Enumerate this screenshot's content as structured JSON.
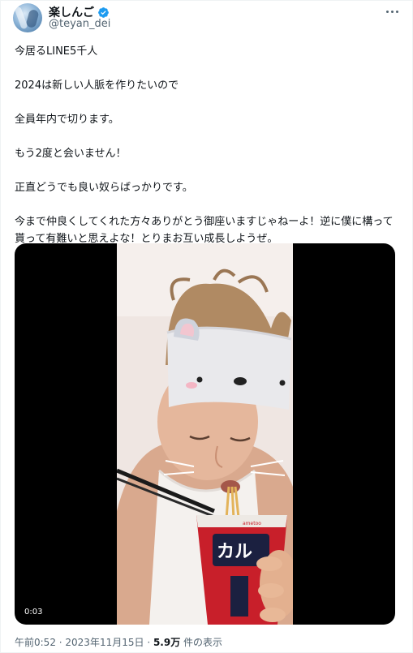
{
  "author": {
    "display_name": "楽しんご",
    "handle": "@teyan_dei",
    "verified": true,
    "verified_color": "#1d9bf0"
  },
  "tweet": {
    "paragraphs": [
      "今居るLINE5千人",
      "2024は新しい人脈を作りたいので",
      "全員年内で切ります。",
      "もう2度と会いません！",
      "正直どうでも良い奴らばっかりです。",
      "今まで仲良くしてくれた方々ありがとう御座いますじゃねーよ！逆に僕に構って貰って有難いと思えよな！とりまお互い成長しようぜ。"
    ]
  },
  "media": {
    "type": "video",
    "duration": "0:03",
    "cup_brand": "ametoo"
  },
  "meta": {
    "time": "午前0:52",
    "separator1": " · ",
    "date": "2023年11月15日",
    "separator2": " · ",
    "views_count": "5.9万",
    "views_label": " 件の表示"
  },
  "icons": {
    "more": "more-horizontal-icon",
    "verified": "verified-badge-icon"
  }
}
